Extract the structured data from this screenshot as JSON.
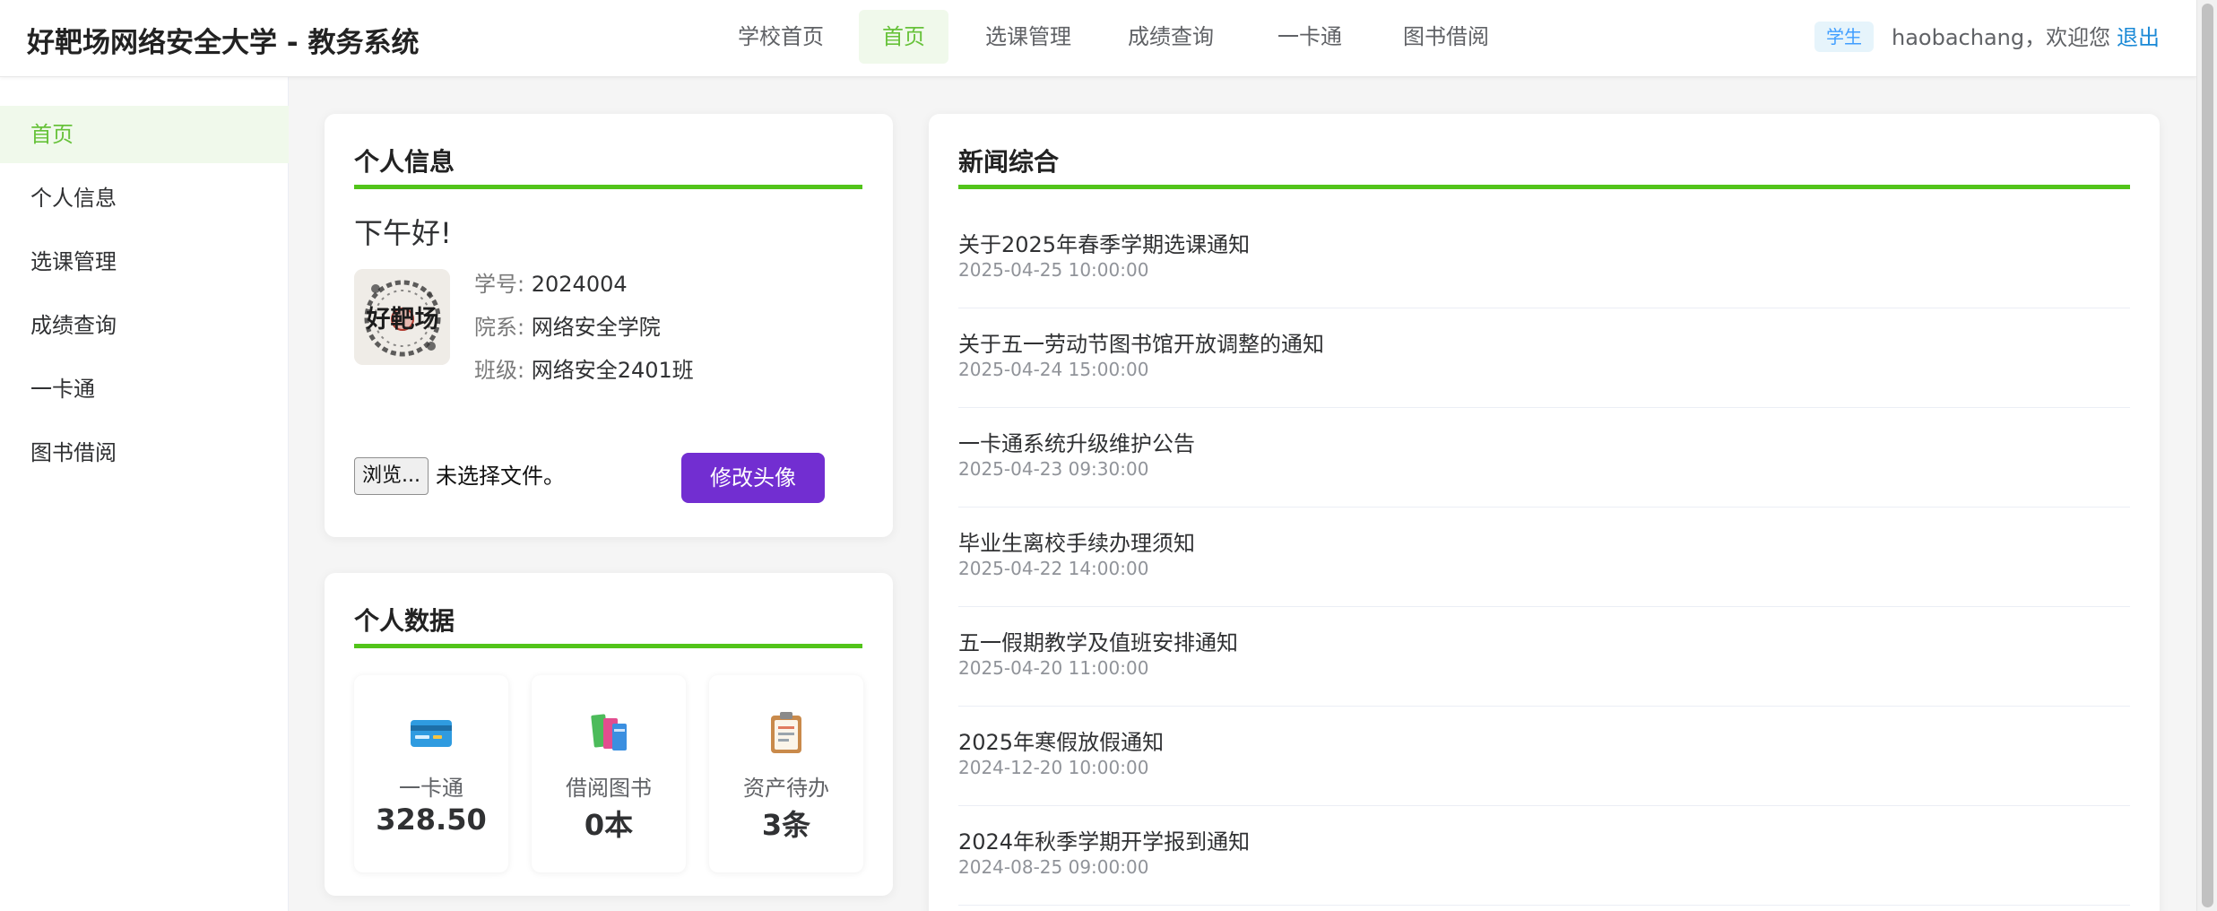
{
  "header": {
    "brand": "好靶场网络安全大学 - 教务系统",
    "nav": [
      {
        "label": "学校首页",
        "active": false
      },
      {
        "label": "首页",
        "active": true
      },
      {
        "label": "选课管理",
        "active": false
      },
      {
        "label": "成绩查询",
        "active": false
      },
      {
        "label": "一卡通",
        "active": false
      },
      {
        "label": "图书借阅",
        "active": false
      }
    ],
    "role_tag": "学生",
    "welcome": "haobachang，欢迎您",
    "logout": "退出"
  },
  "sidebar": {
    "items": [
      {
        "label": "首页",
        "active": true
      },
      {
        "label": "个人信息",
        "active": false
      },
      {
        "label": "选课管理",
        "active": false
      },
      {
        "label": "成绩查询",
        "active": false
      },
      {
        "label": "一卡通",
        "active": false
      },
      {
        "label": "图书借阅",
        "active": false
      }
    ]
  },
  "profile": {
    "title": "个人信息",
    "greeting": "下午好!",
    "avatar_text": "好靶场",
    "fields": [
      {
        "label": "学号:",
        "value": "2024004"
      },
      {
        "label": "院系:",
        "value": "网络安全学院"
      },
      {
        "label": "班级:",
        "value": "网络安全2401班"
      }
    ],
    "file_button": "浏览...",
    "file_status": "未选择文件。",
    "submit_label": "修改头像"
  },
  "stats": {
    "title": "个人数据",
    "items": [
      {
        "icon": "card-icon",
        "label": "一卡通",
        "value": "328.50"
      },
      {
        "icon": "books-icon",
        "label": "借阅图书",
        "value": "0本"
      },
      {
        "icon": "clipboard-icon",
        "label": "资产待办",
        "value": "3条"
      }
    ]
  },
  "news": {
    "title": "新闻综合",
    "items": [
      {
        "title": "关于2025年春季学期选课通知",
        "time": "2025-04-25 10:00:00"
      },
      {
        "title": "关于五一劳动节图书馆开放调整的通知",
        "time": "2025-04-24 15:00:00"
      },
      {
        "title": "一卡通系统升级维护公告",
        "time": "2025-04-23 09:30:00"
      },
      {
        "title": "毕业生离校手续办理须知",
        "time": "2025-04-22 14:00:00"
      },
      {
        "title": "五一假期教学及值班安排通知",
        "time": "2025-04-20 11:00:00"
      },
      {
        "title": "2025年寒假放假通知",
        "time": "2024-12-20 10:00:00"
      },
      {
        "title": "2024年秋季学期开学报到通知",
        "time": "2024-08-25 09:00:00"
      }
    ]
  },
  "colors": {
    "accent_green": "#52c41a",
    "active_green": "#67c23a",
    "purple_button": "#722ed1",
    "link_blue": "#1a89d6"
  }
}
